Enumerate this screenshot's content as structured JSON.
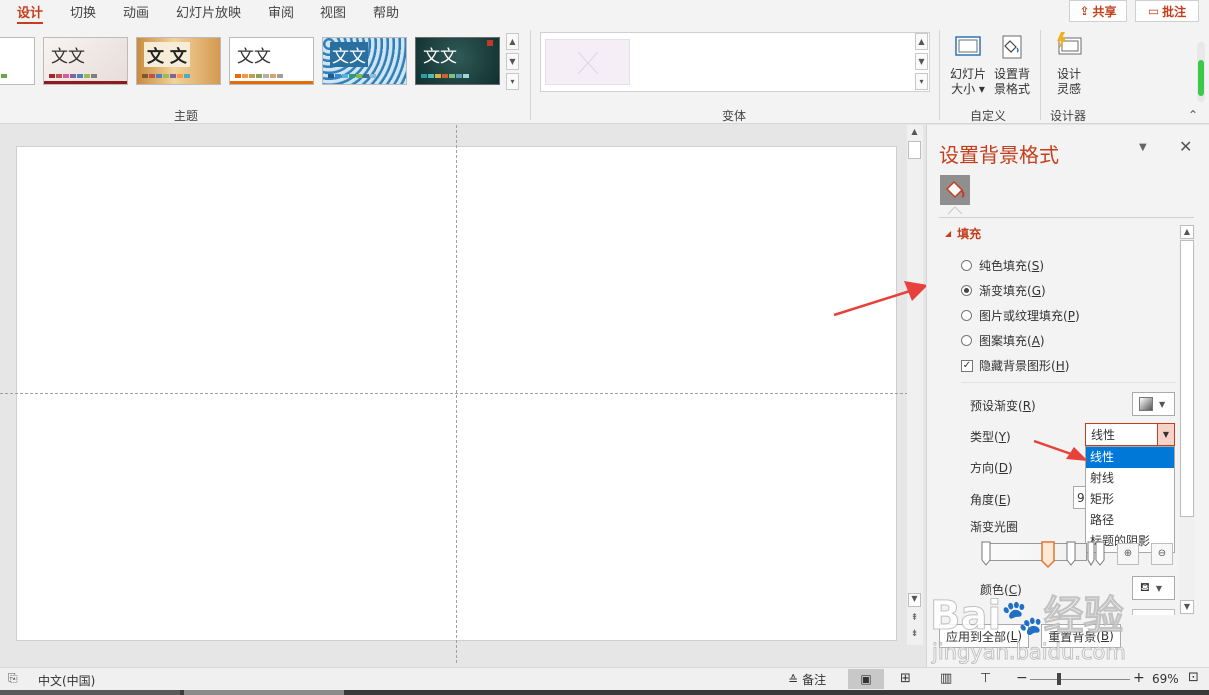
{
  "tabs": [
    "设计",
    "切换",
    "动画",
    "幻灯片放映",
    "审阅",
    "视图",
    "帮助"
  ],
  "active_tab": "设计",
  "top_buttons": {
    "share": "共享",
    "comment": "批注"
  },
  "ribbon": {
    "themes_label": "主题",
    "theme_thumb_text": "文文",
    "theme_thumb_text_alt": "文 文",
    "variants_label": "变体",
    "customize_label": "自定义",
    "designer_label": "设计器",
    "slide_size_label_1": "幻灯片",
    "slide_size_label_2": "大小",
    "format_bg_label_1": "设置背",
    "format_bg_label_2": "景格式",
    "design_ideas_label_1": "设计",
    "design_ideas_label_2": "灵感"
  },
  "pane": {
    "title": "设置背景格式",
    "section_fill": "填充",
    "fill_solid": "纯色填充(",
    "fill_solid_key": "S",
    "fill_gradient": "渐变填充(",
    "fill_gradient_key": "G",
    "fill_picture": "图片或纹理填充(",
    "fill_picture_key": "P",
    "fill_pattern": "图案填充(",
    "fill_pattern_key": "A",
    "hide_bg": "隐藏背景图形(",
    "hide_bg_key": "H",
    "preset_gradient": "预设渐变(",
    "preset_gradient_key": "R",
    "type_label": "类型(",
    "type_key": "Y",
    "type_value": "线性",
    "direction_label": "方向(",
    "direction_key": "D",
    "angle_label": "角度(",
    "angle_key": "E",
    "angle_value_partial": "9",
    "gradient_stops": "渐变光圈",
    "color_label": "颜色(",
    "color_key": "C",
    "close_paren": ")",
    "apply_all": "应用到全部(",
    "apply_all_key": "L",
    "reset_bg": "重置背景(",
    "reset_bg_key": "B"
  },
  "type_options": [
    "线性",
    "射线",
    "矩形",
    "路径",
    "标题的阴影"
  ],
  "type_selected_index": 0,
  "status": {
    "language": "中文(中国)",
    "notes": "备注",
    "zoom": "69%"
  },
  "watermark": {
    "brand": "Bai",
    "brand2": "经验",
    "url": "jingyan.baidu.com"
  },
  "colors": {
    "accent": "#c43e1c",
    "selection": "#0078d7",
    "annotation_arrow": "#e8413b"
  }
}
